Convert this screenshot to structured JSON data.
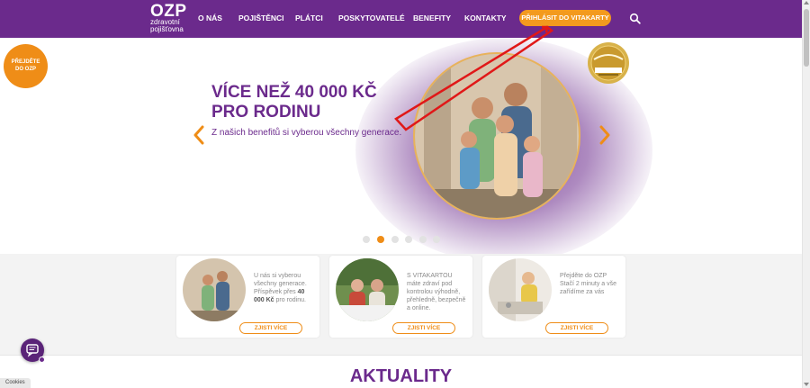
{
  "header": {
    "logo_main": "OZP",
    "logo_line1": "zdravotní",
    "logo_line2": "pojišťovna",
    "nav": [
      "O NÁS",
      "POJIŠTĚNCI",
      "PLÁTCI",
      "POSKYTOVATELÉ",
      "BENEFITY",
      "KONTAKTY"
    ],
    "vitakarta_label": "PŘIHLÁSIT DO VITAKARTY"
  },
  "switch_badge": {
    "line1": "PŘEJDĚTE",
    "line2": "DO OZP"
  },
  "hero": {
    "title_line1": "VÍCE NEŽ 40 000 KČ",
    "title_line2": "PRO RODINU",
    "subtitle": "Z našich benefitů si vyberou všechny generace.",
    "slides_total": 6,
    "active_slide": 2
  },
  "cards": [
    {
      "text_before": "U nás si vyberou všechny generace. Příspěvek přes ",
      "text_bold": "40 000 Kč",
      "text_after": " pro rodinu.",
      "button": "ZJISTI VÍCE"
    },
    {
      "text_before": "S VITAKARTOU máte zdraví pod kontrolou výhodně, přehledně, bezpečně a online.",
      "text_bold": "",
      "text_after": "",
      "button": "ZJISTI VÍCE"
    },
    {
      "text_before": "Přejděte do OZP Stačí 2 minuty a vše zařídíme za vás",
      "text_bold": "",
      "text_after": "",
      "button": "ZJISTI VÍCE"
    }
  ],
  "section_title": "AKTUALITY",
  "cookies_label": "Cookies",
  "colors": {
    "brand_purple": "#6b2a8c",
    "accent_orange": "#ef8d17",
    "annotation_red": "#e01818"
  }
}
